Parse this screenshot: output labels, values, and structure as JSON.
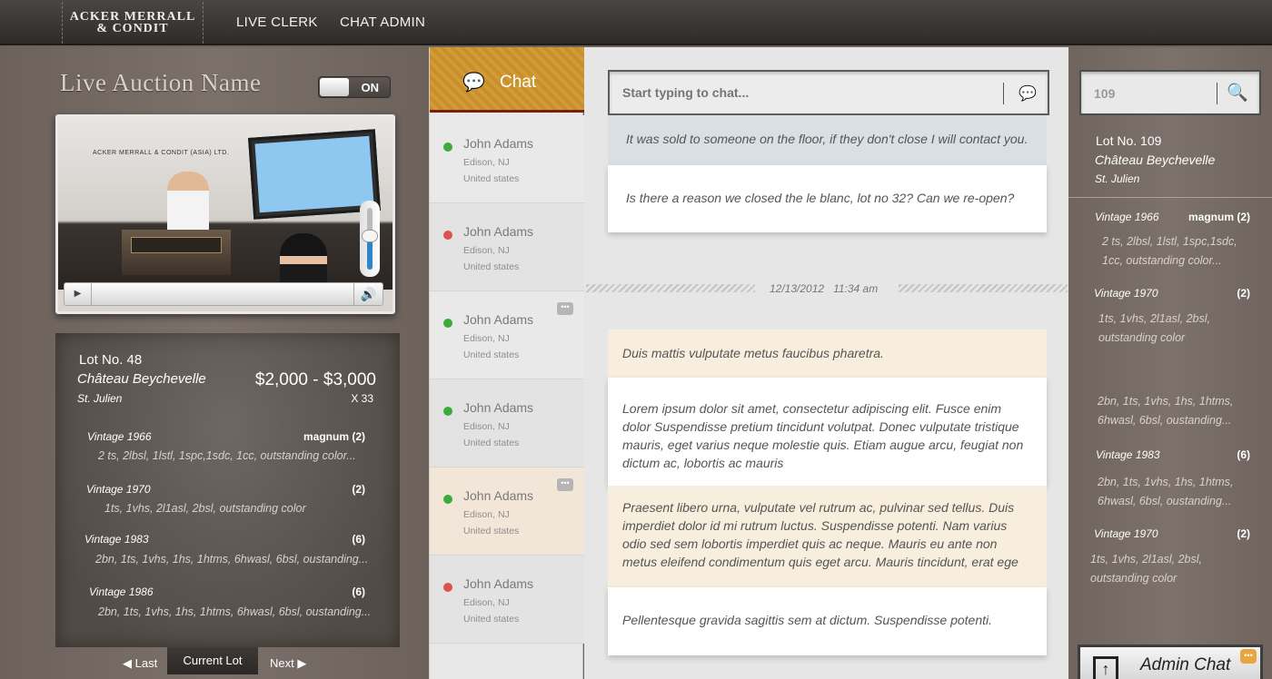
{
  "topbar": {
    "logo_line1": "ACKER MERRALL",
    "logo_line2": "& CONDIT",
    "nav": [
      "LIVE CLERK",
      "CHAT ADMIN"
    ]
  },
  "auction": {
    "name": "Live Auction Name",
    "toggle_label": "ON"
  },
  "video": {
    "brand_text": "ACKER MERRALL & CONDIT (ASIA) LTD.",
    "volume_level": 0.55
  },
  "current_lot": {
    "lot_no": "Lot No. 48",
    "name": "Château Beychevelle",
    "location": "St. Julien",
    "price": "$2,000 - $3,000",
    "qty": "X 33",
    "vintages": [
      {
        "title": "Vintage 1966",
        "size": "magnum (2)",
        "desc": "2 ts, 2lbsl, 1lstl, 1spc,1sdc, 1cc, outstanding color..."
      },
      {
        "title": "Vintage 1970",
        "size": "(2)",
        "desc": "1ts, 1vhs, 2l1asl, 2bsl, outstanding color"
      },
      {
        "title": "Vintage 1983",
        "size": "(6)",
        "desc": "2bn, 1ts, 1vhs, 1hs, 1htms, 6hwasl, 6bsl, oustanding..."
      },
      {
        "title": "Vintage 1986",
        "size": "(6)",
        "desc": "2bn, 1ts, 1vhs, 1hs, 1htms, 6hwasl, 6bsl, oustanding..."
      }
    ]
  },
  "lot_nav": {
    "last": "Last",
    "current": "Current Lot",
    "next": "Next"
  },
  "chat_list": {
    "title": "Chat",
    "users": [
      {
        "name": "John Adams",
        "city": "Edison, NJ",
        "country": "United states",
        "status": "online",
        "has_message": false
      },
      {
        "name": "John Adams",
        "city": "Edison, NJ",
        "country": "United states",
        "status": "offline",
        "has_message": false
      },
      {
        "name": "John Adams",
        "city": "Edison, NJ",
        "country": "United states",
        "status": "online",
        "has_message": true
      },
      {
        "name": "John Adams",
        "city": "Edison, NJ",
        "country": "United states",
        "status": "online",
        "has_message": false
      },
      {
        "name": "John Adams",
        "city": "Edison, NJ",
        "country": "United states",
        "status": "online",
        "has_message": true
      },
      {
        "name": "John Adams",
        "city": "Edison, NJ",
        "country": "United states",
        "status": "offline",
        "has_message": false
      }
    ]
  },
  "chat": {
    "placeholder": "Start typing to chat...",
    "messages_top": [
      "It was sold to someone on the floor, if they don't close I will contact you.",
      "Is there a reason we closed the le blanc, lot no 32? Can we re-open?"
    ],
    "date": "12/13/2012",
    "time": "11:34 am",
    "messages_bottom": [
      "Duis mattis vulputate metus faucibus pharetra.",
      "Lorem ipsum dolor sit amet, consectetur adipiscing elit. Fusce enim dolor Suspendisse pretium tincidunt volutpat. Donec vulputate tristique mauris, eget varius neque molestie quis. Etiam augue arcu, feugiat non dictum ac, lobortis ac mauris",
      "Praesent libero urna, vulputate vel rutrum ac, pulvinar sed tellus. Duis imperdiet dolor id mi rutrum luctus. Suspendisse potenti. Nam varius odio sed sem lobortis imperdiet quis ac neque. Mauris eu ante non metus eleifend condimentum quis eget arcu. Mauris tincidunt, erat ege",
      "Pellentesque gravida sagittis sem at dictum. Suspendisse potenti."
    ]
  },
  "search": {
    "value": "109"
  },
  "search_lot": {
    "lot_no": "Lot No. 109",
    "name": "Château Beychevelle",
    "location": "St. Julien",
    "vintages": [
      {
        "title": "Vintage 1966",
        "size": "magnum (2)",
        "desc": "2 ts, 2lbsl, 1lstl, 1spc,1sdc, 1cc, outstanding color..."
      },
      {
        "title": "Vintage 1970",
        "size": "(2)",
        "desc": "1ts, 1vhs, 2l1asl, 2bsl, outstanding color"
      },
      {
        "title": "",
        "size": "",
        "desc": "2bn, 1ts, 1vhs, 1hs, 1htms, 6hwasl, 6bsl, oustanding..."
      },
      {
        "title": "Vintage 1983",
        "size": "(6)",
        "desc": "2bn, 1ts, 1vhs, 1hs, 1htms, 6hwasl, 6bsl, oustanding..."
      },
      {
        "title": "Vintage 1970",
        "size": "(2)",
        "desc": "1ts, 1vhs, 2l1asl, 2bsl, outstanding color"
      }
    ]
  },
  "admin_chat": {
    "label": "Admin Chat"
  },
  "colors": {
    "online": "#3cab3c",
    "offline": "#d9534f",
    "chat_header": "#c88f2c",
    "accent_red": "#7c1e10"
  }
}
